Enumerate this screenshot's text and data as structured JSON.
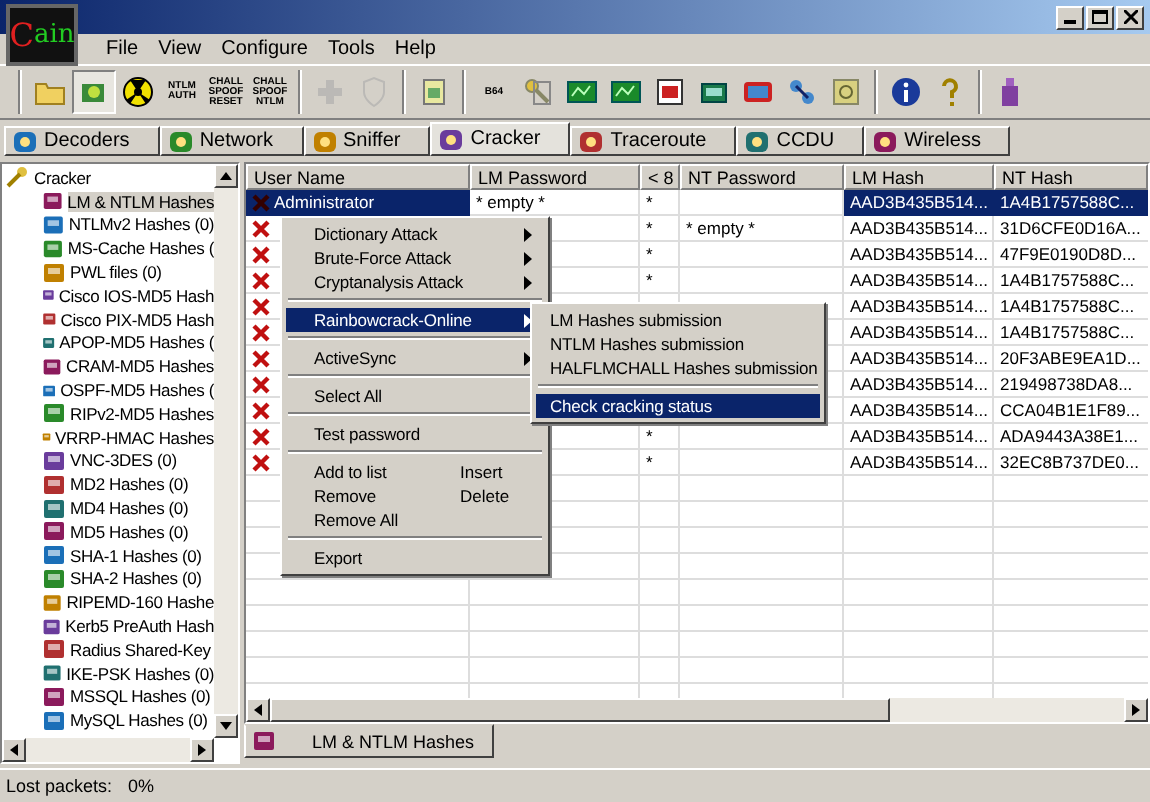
{
  "window": {
    "logo": "Cain"
  },
  "menu": [
    "File",
    "View",
    "Configure",
    "Tools",
    "Help"
  ],
  "toolbar": [
    {
      "kind": "folder",
      "pressed": false,
      "disabled": false,
      "separator_before": false
    },
    {
      "kind": "sniffer",
      "pressed": true,
      "disabled": false,
      "separator_before": false
    },
    {
      "kind": "radiation",
      "pressed": false,
      "disabled": false,
      "separator_before": false
    },
    {
      "kind": "text",
      "label": "NTLM AUTH",
      "pressed": false,
      "disabled": false,
      "separator_before": false
    },
    {
      "kind": "text",
      "label": "CHALL SPOOF RESET",
      "pressed": false,
      "disabled": false,
      "separator_before": false
    },
    {
      "kind": "text",
      "label": "CHALL SPOOF NTLM",
      "pressed": false,
      "disabled": false,
      "separator_before": false
    },
    {
      "kind": "plus",
      "pressed": false,
      "disabled": true,
      "separator_before": true
    },
    {
      "kind": "shield",
      "pressed": false,
      "disabled": true,
      "separator_before": false
    },
    {
      "kind": "document",
      "pressed": false,
      "disabled": false,
      "separator_before": true
    },
    {
      "kind": "text",
      "label": "B64",
      "pressed": false,
      "disabled": false,
      "separator_before": true
    },
    {
      "kind": "key",
      "pressed": false,
      "disabled": false,
      "separator_before": false
    },
    {
      "kind": "screen",
      "pressed": false,
      "disabled": false,
      "separator_before": false
    },
    {
      "kind": "screen",
      "pressed": false,
      "disabled": false,
      "separator_before": false
    },
    {
      "kind": "card",
      "pressed": false,
      "disabled": false,
      "separator_before": false
    },
    {
      "kind": "monitor",
      "pressed": false,
      "disabled": false,
      "separator_before": false
    },
    {
      "kind": "window",
      "pressed": false,
      "disabled": false,
      "separator_before": false
    },
    {
      "kind": "network",
      "pressed": false,
      "disabled": false,
      "separator_before": false
    },
    {
      "kind": "lock",
      "pressed": false,
      "disabled": false,
      "separator_before": false
    },
    {
      "kind": "info",
      "pressed": false,
      "disabled": false,
      "separator_before": true
    },
    {
      "kind": "help",
      "pressed": false,
      "disabled": false,
      "separator_before": false
    },
    {
      "kind": "bottle",
      "pressed": false,
      "disabled": false,
      "separator_before": true
    }
  ],
  "tabs": [
    {
      "label": "Decoders",
      "selected": false
    },
    {
      "label": "Network",
      "selected": false
    },
    {
      "label": "Sniffer",
      "selected": false
    },
    {
      "label": "Cracker",
      "selected": true
    },
    {
      "label": "Traceroute",
      "selected": false
    },
    {
      "label": "CCDU",
      "selected": false
    },
    {
      "label": "Wireless",
      "selected": false
    }
  ],
  "tree": {
    "label": "Cracker",
    "children": [
      {
        "label": "LM & NTLM Hashes",
        "selected": true
      },
      {
        "label": "NTLMv2 Hashes (0)",
        "selected": false
      },
      {
        "label": "MS-Cache Hashes (",
        "selected": false
      },
      {
        "label": "PWL files (0)",
        "selected": false
      },
      {
        "label": "Cisco IOS-MD5 Hash",
        "selected": false
      },
      {
        "label": "Cisco PIX-MD5 Hash",
        "selected": false
      },
      {
        "label": "APOP-MD5 Hashes (",
        "selected": false
      },
      {
        "label": "CRAM-MD5 Hashes",
        "selected": false
      },
      {
        "label": "OSPF-MD5 Hashes (",
        "selected": false
      },
      {
        "label": "RIPv2-MD5 Hashes",
        "selected": false
      },
      {
        "label": "VRRP-HMAC Hashes",
        "selected": false
      },
      {
        "label": "VNC-3DES (0)",
        "selected": false
      },
      {
        "label": "MD2 Hashes (0)",
        "selected": false
      },
      {
        "label": "MD4 Hashes (0)",
        "selected": false
      },
      {
        "label": "MD5 Hashes (0)",
        "selected": false
      },
      {
        "label": "SHA-1 Hashes (0)",
        "selected": false
      },
      {
        "label": "SHA-2 Hashes (0)",
        "selected": false
      },
      {
        "label": "RIPEMD-160 Hashe",
        "selected": false
      },
      {
        "label": "Kerb5 PreAuth Hash",
        "selected": false
      },
      {
        "label": "Radius Shared-Key",
        "selected": false
      },
      {
        "label": "IKE-PSK Hashes (0)",
        "selected": false
      },
      {
        "label": "MSSQL Hashes (0)",
        "selected": false
      },
      {
        "label": "MySQL Hashes (0)",
        "selected": false
      }
    ]
  },
  "table": {
    "columns": [
      "User Name",
      "LM Password",
      "< 8",
      "NT Password",
      "LM Hash",
      "NT Hash"
    ],
    "rows": [
      {
        "selected": true,
        "cells": [
          "Administrator",
          "* empty *",
          "*",
          "",
          "AAD3B435B514...",
          "1A4B1757588C..."
        ]
      },
      {
        "selected": false,
        "cells": [
          "",
          "",
          "*",
          "* empty *",
          "AAD3B435B514...",
          "31D6CFE0D16A..."
        ]
      },
      {
        "selected": false,
        "cells": [
          "",
          "",
          "*",
          "",
          "AAD3B435B514...",
          "47F9E0190D8D..."
        ]
      },
      {
        "selected": false,
        "cells": [
          "",
          "",
          "*",
          "",
          "AAD3B435B514...",
          "1A4B1757588C..."
        ]
      },
      {
        "selected": false,
        "cells": [
          "",
          "",
          "",
          "",
          "AAD3B435B514...",
          "1A4B1757588C..."
        ]
      },
      {
        "selected": false,
        "cells": [
          "",
          "",
          "",
          "",
          "AAD3B435B514...",
          "1A4B1757588C..."
        ]
      },
      {
        "selected": false,
        "cells": [
          "",
          "",
          "",
          "",
          "AAD3B435B514...",
          "20F3ABE9EA1D..."
        ]
      },
      {
        "selected": false,
        "cells": [
          "",
          "",
          "",
          "",
          "AAD3B435B514...",
          "219498738DA8..."
        ]
      },
      {
        "selected": false,
        "cells": [
          "",
          "",
          "",
          "",
          "AAD3B435B514...",
          "CCA04B1E1F89..."
        ]
      },
      {
        "selected": false,
        "cells": [
          "",
          "",
          "*",
          "",
          "AAD3B435B514...",
          "ADA9443A38E1..."
        ]
      },
      {
        "selected": false,
        "cells": [
          "",
          "",
          "*",
          "",
          "AAD3B435B514...",
          "32EC8B737DE0..."
        ]
      }
    ]
  },
  "context_menu": [
    {
      "kind": "item",
      "label": "Dictionary Attack",
      "submenu": true,
      "selected": false
    },
    {
      "kind": "item",
      "label": "Brute-Force Attack",
      "submenu": true,
      "selected": false
    },
    {
      "kind": "item",
      "label": "Cryptanalysis Attack",
      "submenu": true,
      "selected": false
    },
    {
      "kind": "separator"
    },
    {
      "kind": "item",
      "label": "Rainbowcrack-Online",
      "submenu": true,
      "selected": true
    },
    {
      "kind": "separator"
    },
    {
      "kind": "item",
      "label": "ActiveSync",
      "submenu": true,
      "selected": false
    },
    {
      "kind": "separator"
    },
    {
      "kind": "item",
      "label": "Select All",
      "submenu": false,
      "selected": false
    },
    {
      "kind": "separator"
    },
    {
      "kind": "item",
      "label": "Test password",
      "submenu": false,
      "selected": false
    },
    {
      "kind": "separator"
    },
    {
      "kind": "item",
      "label": "Add to list",
      "shortcut": "Insert",
      "submenu": false,
      "selected": false
    },
    {
      "kind": "item",
      "label": "Remove",
      "shortcut": "Delete",
      "submenu": false,
      "selected": false
    },
    {
      "kind": "item",
      "label": "Remove All",
      "submenu": false,
      "selected": false
    },
    {
      "kind": "separator"
    },
    {
      "kind": "item",
      "label": "Export",
      "submenu": false,
      "selected": false
    }
  ],
  "submenu": [
    {
      "kind": "item",
      "label": "LM Hashes submission",
      "selected": false
    },
    {
      "kind": "item",
      "label": "NTLM Hashes submission",
      "selected": false
    },
    {
      "kind": "item",
      "label": "HALFLMCHALL Hashes submission",
      "selected": false
    },
    {
      "kind": "separator"
    },
    {
      "kind": "item",
      "label": "Check cracking status",
      "selected": true
    }
  ],
  "bottom_tab": {
    "label": "LM & NTLM Hashes"
  },
  "status_bar": {
    "label": "Lost packets:",
    "value": "0%"
  }
}
